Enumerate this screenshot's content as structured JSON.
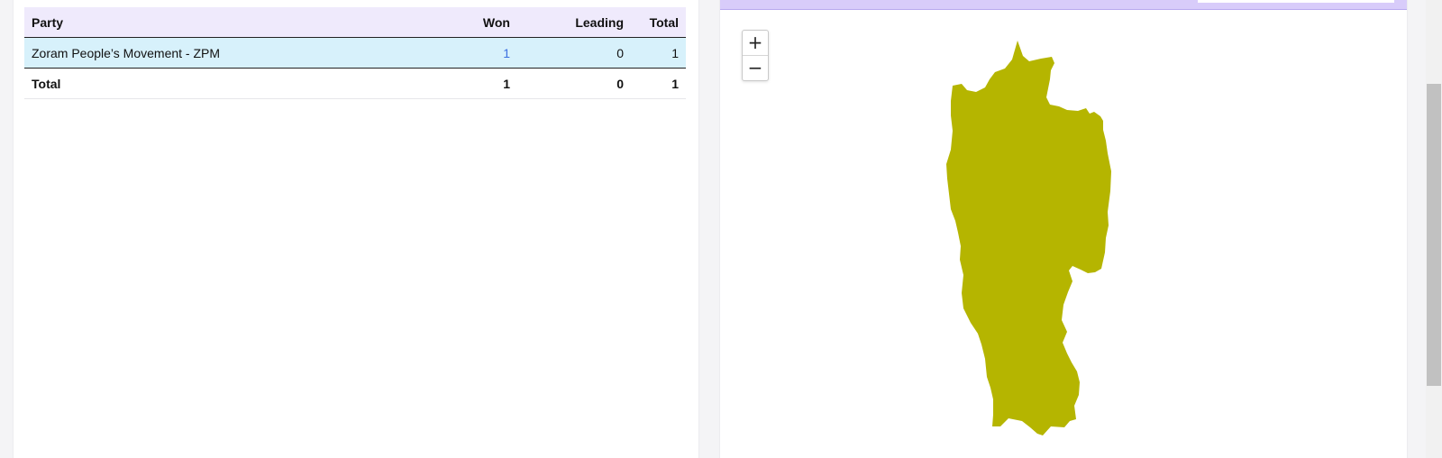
{
  "results_table": {
    "headers": {
      "party": "Party",
      "won": "Won",
      "leading": "Leading",
      "total": "Total"
    },
    "rows": [
      {
        "party": "Zoram People’s Movement - ZPM",
        "won": "1",
        "leading": "0",
        "total": "1"
      }
    ],
    "totals": {
      "label": "Total",
      "won": "1",
      "leading": "0",
      "total": "1"
    }
  },
  "map": {
    "zoom_in_label": "+",
    "zoom_out_label": "−",
    "region_fill": "#b5b500",
    "zoom_in_icon": "plus-icon",
    "zoom_out_icon": "minus-icon"
  },
  "colors": {
    "header_bg": "#efeafc",
    "party_row_bg": "#d7f1fb",
    "won_link": "#3b6fe0",
    "map_band": "#d8ccfa"
  }
}
